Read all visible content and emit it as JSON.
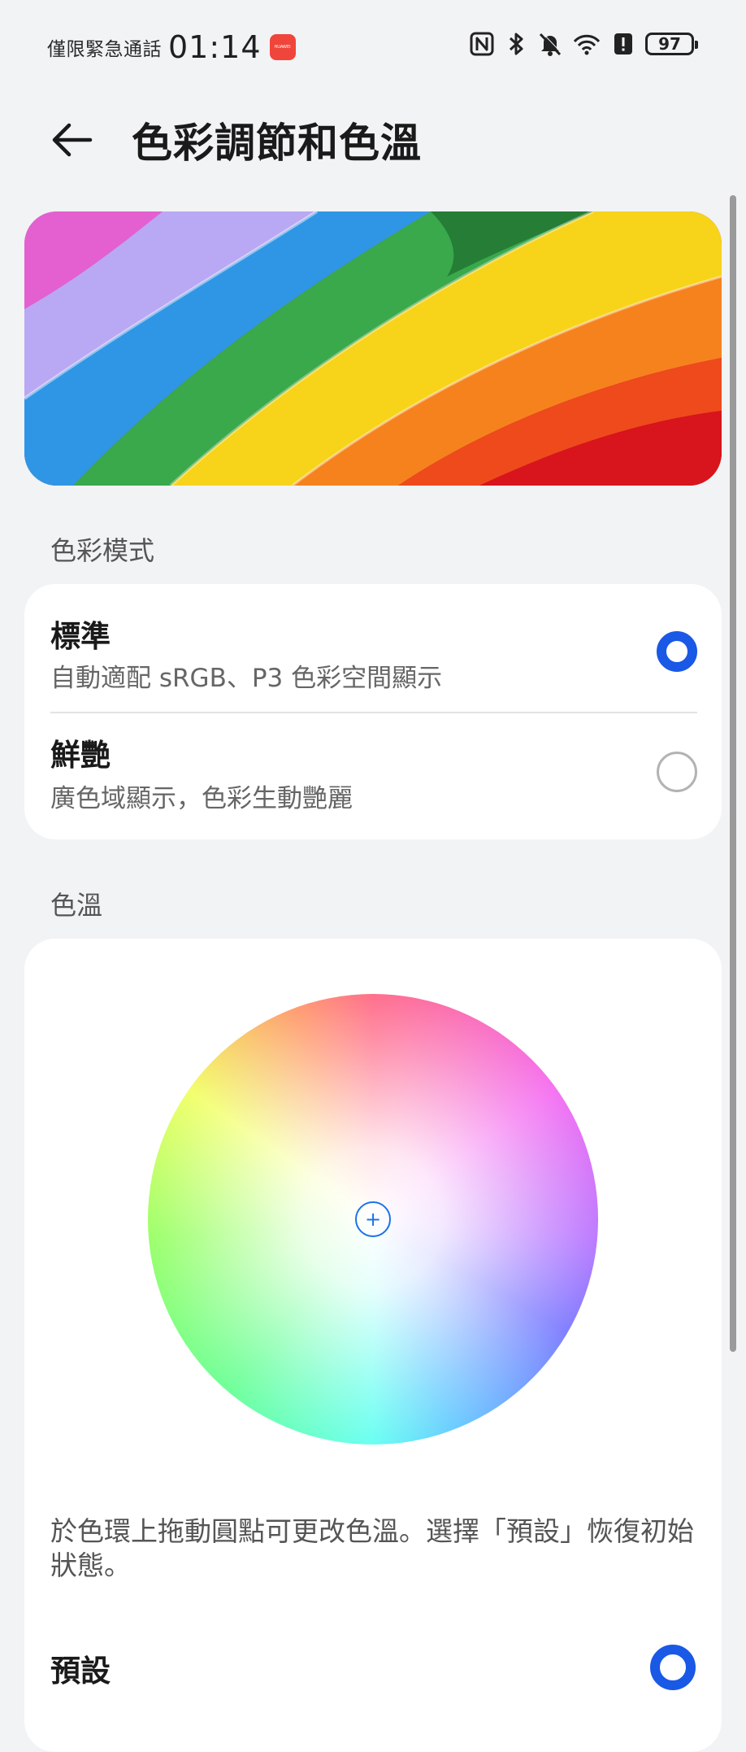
{
  "status_bar": {
    "emergency_text": "僅限緊急通話",
    "time": "01:14",
    "app_badge": "HUAWEI",
    "icons": [
      "nfc-icon",
      "bluetooth-icon",
      "mute-icon",
      "wifi-icon",
      "alert-icon"
    ],
    "battery": "97"
  },
  "header": {
    "title": "色彩調節和色溫"
  },
  "color_mode": {
    "section_label": "色彩模式",
    "options": [
      {
        "title": "標準",
        "subtitle": "自動適配 sRGB、P3 色彩空間顯示",
        "selected": true
      },
      {
        "title": "鮮艷",
        "subtitle": "廣色域顯示，色彩生動艷麗",
        "selected": false
      }
    ]
  },
  "color_temp": {
    "section_label": "色溫",
    "description": "於色環上拖動圓點可更改色溫。選擇「預設」恢復初始狀態。",
    "preset_label": "預設",
    "preset_selected": true
  },
  "colors": {
    "accent": "#1a58e6",
    "background": "#f1f3f5",
    "card": "#ffffff"
  }
}
